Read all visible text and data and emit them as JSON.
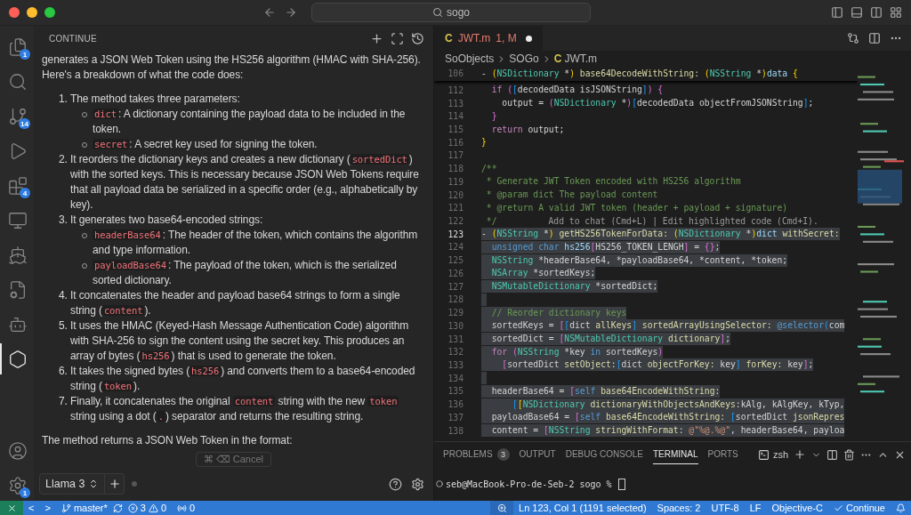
{
  "window": {
    "search": "sogo"
  },
  "activity_bar": {
    "top": [
      {
        "kind": "explorer",
        "badge": "1",
        "selected": false
      },
      {
        "kind": "search",
        "selected": false
      },
      {
        "kind": "source-control",
        "badge": "14",
        "selected": false
      },
      {
        "kind": "run",
        "selected": false
      },
      {
        "kind": "extensions",
        "badge": "4",
        "selected": false
      },
      {
        "kind": "remote",
        "selected": false
      },
      {
        "kind": "docker",
        "selected": false
      },
      {
        "kind": "file-settings",
        "selected": false
      },
      {
        "kind": "robot",
        "selected": false
      },
      {
        "kind": "continue",
        "selected": true
      }
    ],
    "bottom": [
      {
        "kind": "account",
        "selected": false
      },
      {
        "kind": "manage",
        "badge": "1",
        "selected": false
      }
    ]
  },
  "chat": {
    "title": "CONTINUE",
    "blocks": [
      {
        "kind": "paragraph",
        "segments": [
          {
            "text": "generates a JSON Web Token using the HS256 algorithm (HMAC with SHA-256). Here's a breakdown of what the code does:",
            "kind": "text"
          }
        ]
      },
      {
        "kind": "list",
        "items": [
          {
            "number": "1.",
            "segments": [
              {
                "text": "The method takes three parameters:",
                "kind": "text"
              }
            ],
            "children": [
              {
                "segments": [
                  {
                    "text": "dict",
                    "kind": "code"
                  },
                  {
                    "text": ": A dictionary containing the payload data to be included in the token.",
                    "kind": "text"
                  }
                ]
              },
              {
                "segments": [
                  {
                    "text": "secret",
                    "kind": "code"
                  },
                  {
                    "text": ": A secret key used for signing the token.",
                    "kind": "text"
                  }
                ]
              }
            ]
          },
          {
            "number": "2.",
            "segments": [
              {
                "text": "It reorders the dictionary keys and creates a new dictionary (",
                "kind": "text"
              },
              {
                "text": "sortedDict",
                "kind": "code"
              },
              {
                "text": ") with the sorted keys. This is necessary because JSON Web Tokens require that all payload data be serialized in a specific order (e.g., alphabetically by key).",
                "kind": "text"
              }
            ]
          },
          {
            "number": "3.",
            "segments": [
              {
                "text": "It generates two base64-encoded strings:",
                "kind": "text"
              }
            ],
            "children": [
              {
                "segments": [
                  {
                    "text": "headerBase64",
                    "kind": "code"
                  },
                  {
                    "text": ": The header of the token, which contains the algorithm and type information.",
                    "kind": "text"
                  }
                ]
              },
              {
                "segments": [
                  {
                    "text": "payloadBase64",
                    "kind": "code"
                  },
                  {
                    "text": ": The payload of the token, which is the serialized sorted dictionary.",
                    "kind": "text"
                  }
                ]
              }
            ]
          },
          {
            "number": "4.",
            "segments": [
              {
                "text": "It concatenates the header and payload base64 strings to form a single string (",
                "kind": "text"
              },
              {
                "text": "content",
                "kind": "code"
              },
              {
                "text": ").",
                "kind": "text"
              }
            ]
          },
          {
            "number": "5.",
            "segments": [
              {
                "text": "It uses the HMAC (Keyed-Hash Message Authentication Code) algorithm with SHA-256 to sign the content using the secret key. This produces an array of bytes (",
                "kind": "text"
              },
              {
                "text": "hs256",
                "kind": "code"
              },
              {
                "text": ") that is used to generate the token.",
                "kind": "text"
              }
            ]
          },
          {
            "number": "6.",
            "segments": [
              {
                "text": "It takes the signed bytes (",
                "kind": "text"
              },
              {
                "text": "hs256",
                "kind": "code"
              },
              {
                "text": ") and converts them to a base64-encoded string (",
                "kind": "text"
              },
              {
                "text": "token",
                "kind": "code"
              },
              {
                "text": ").",
                "kind": "text"
              }
            ]
          },
          {
            "number": "7.",
            "segments": [
              {
                "text": "Finally, it concatenates the original ",
                "kind": "text"
              },
              {
                "text": "content",
                "kind": "code"
              },
              {
                "text": " string with the new ",
                "kind": "text"
              },
              {
                "text": "token",
                "kind": "code"
              },
              {
                "text": " string using a dot (",
                "kind": "text"
              },
              {
                "text": ".",
                "kind": "code"
              },
              {
                "text": ") separator and returns the resulting string.",
                "kind": "text"
              }
            ]
          }
        ]
      },
      {
        "kind": "paragraph",
        "segments": [
          {
            "text": "The method returns a JSON Web Token in the format:",
            "kind": "text"
          }
        ]
      }
    ],
    "cancel_button": "⌘ ⌫ Cancel",
    "model": "Llama 3"
  },
  "editor": {
    "tab": {
      "icon_letter": "C",
      "name": "JWT.m",
      "status": "1, M",
      "modified": true
    },
    "breadcrumb": [
      {
        "label": "SoObjects"
      },
      {
        "label": "SOGo"
      },
      {
        "icon_letter": "C",
        "label": "JWT.m"
      }
    ],
    "sticky_line": {
      "n": "106",
      "seg": [
        {
          "text": "- ",
          "kind": "p"
        },
        {
          "text": "(",
          "kind": "y"
        },
        {
          "text": "NSDictionary",
          "kind": "t"
        },
        {
          "text": " *",
          "kind": "p"
        },
        {
          "text": ")",
          "kind": "y"
        },
        {
          "text": " base64DecodeWithString: ",
          "kind": "f"
        },
        {
          "text": "(",
          "kind": "y"
        },
        {
          "text": "NSString",
          "kind": "t"
        },
        {
          "text": " *",
          "kind": "p"
        },
        {
          "text": ")",
          "kind": "y"
        },
        {
          "text": "data",
          "kind": "v"
        },
        {
          "text": " {",
          "kind": "y"
        }
      ]
    },
    "lines": [
      {
        "n": "112",
        "selected": false,
        "current": false,
        "seg": [
          {
            "text": "  if ",
            "kind": "k"
          },
          {
            "text": "(",
            "kind": "m"
          },
          {
            "text": "[",
            "kind": "b"
          },
          {
            "text": "decodedData isJSONString",
            "kind": "p"
          },
          {
            "text": "]",
            "kind": "b"
          },
          {
            "text": ")",
            "kind": "m"
          },
          {
            "text": " {",
            "kind": "m"
          }
        ]
      },
      {
        "n": "113",
        "selected": false,
        "current": false,
        "seg": [
          {
            "text": "    output = ",
            "kind": "p"
          },
          {
            "text": "(",
            "kind": "m"
          },
          {
            "text": "NSDictionary",
            "kind": "t"
          },
          {
            "text": " *",
            "kind": "p"
          },
          {
            "text": ")",
            "kind": "m"
          },
          {
            "text": "[",
            "kind": "b"
          },
          {
            "text": "decodedData objectFromJSONString",
            "kind": "p"
          },
          {
            "text": "]",
            "kind": "b"
          },
          {
            "text": ";",
            "kind": "p"
          }
        ]
      },
      {
        "n": "114",
        "selected": false,
        "current": false,
        "seg": [
          {
            "text": "  }",
            "kind": "m"
          }
        ]
      },
      {
        "n": "115",
        "selected": false,
        "current": false,
        "seg": [
          {
            "text": "  return",
            "kind": "k"
          },
          {
            "text": " output;",
            "kind": "p"
          }
        ]
      },
      {
        "n": "116",
        "selected": false,
        "current": false,
        "seg": [
          {
            "text": "}",
            "kind": "y"
          }
        ]
      },
      {
        "n": "117",
        "selected": false,
        "current": false
      },
      {
        "n": "118",
        "selected": false,
        "current": false,
        "seg": [
          {
            "text": "/**",
            "kind": "c"
          }
        ]
      },
      {
        "n": "119",
        "selected": false,
        "current": false,
        "seg": [
          {
            "text": " * Generate JWT Token encoded with HS256 algorithm",
            "kind": "c"
          }
        ]
      },
      {
        "n": "120",
        "selected": false,
        "current": false,
        "seg": [
          {
            "text": " * @param dict The payload content",
            "kind": "c"
          }
        ]
      },
      {
        "n": "121",
        "selected": false,
        "current": false,
        "seg": [
          {
            "text": " * @return A valid JWT token (header + payload + signature)",
            "kind": "c"
          }
        ]
      },
      {
        "n": "122",
        "selected": false,
        "current": false,
        "seg": [
          {
            "text": " */",
            "kind": "c"
          }
        ],
        "hint": "Add to chat (Cmd+L) | Edit highlighted code (Cmd+I)."
      },
      {
        "n": "123",
        "selected": true,
        "current": true,
        "seg": [
          {
            "text": "- ",
            "kind": "p"
          },
          {
            "text": "(",
            "kind": "y"
          },
          {
            "text": "NSString",
            "kind": "t"
          },
          {
            "text": " *",
            "kind": "p"
          },
          {
            "text": ")",
            "kind": "y"
          },
          {
            "text": " getHS256TokenForData: ",
            "kind": "f"
          },
          {
            "text": "(",
            "kind": "y"
          },
          {
            "text": "NSDictionary",
            "kind": "t"
          },
          {
            "text": " *",
            "kind": "p"
          },
          {
            "text": ")",
            "kind": "y"
          },
          {
            "text": "dict",
            "kind": "v"
          },
          {
            "text": " withSecret:",
            "kind": "f"
          }
        ]
      },
      {
        "n": "124",
        "selected": true,
        "current": false,
        "seg": [
          {
            "text": "  unsigned char",
            "kind": "s"
          },
          {
            "text": " hs256",
            "kind": "v"
          },
          {
            "text": "[",
            "kind": "m"
          },
          {
            "text": "HS256_TOKEN_LENGH",
            "kind": "p"
          },
          {
            "text": "]",
            "kind": "m"
          },
          {
            "text": " = ",
            "kind": "p"
          },
          {
            "text": "{}",
            "kind": "m"
          },
          {
            "text": ";",
            "kind": "p"
          }
        ]
      },
      {
        "n": "125",
        "selected": true,
        "current": false,
        "seg": [
          {
            "text": "  NSString",
            "kind": "t"
          },
          {
            "text": " *headerBase64, *payloadBase64, *content, *token;",
            "kind": "p"
          }
        ]
      },
      {
        "n": "126",
        "selected": true,
        "current": false,
        "seg": [
          {
            "text": "  NSArray",
            "kind": "t"
          },
          {
            "text": " *sortedKeys;",
            "kind": "p"
          }
        ]
      },
      {
        "n": "127",
        "selected": true,
        "current": false,
        "seg": [
          {
            "text": "  NSMutableDictionary",
            "kind": "t"
          },
          {
            "text": " *sortedDict;",
            "kind": "p"
          }
        ]
      },
      {
        "n": "128",
        "selected": true,
        "current": false
      },
      {
        "n": "129",
        "selected": true,
        "current": false,
        "seg": [
          {
            "text": "  // Reorder dictionary keys",
            "kind": "c"
          }
        ]
      },
      {
        "n": "130",
        "selected": true,
        "current": false,
        "seg": [
          {
            "text": "  sortedKeys = ",
            "kind": "p"
          },
          {
            "text": "[",
            "kind": "m"
          },
          {
            "text": "[",
            "kind": "b"
          },
          {
            "text": "dict ",
            "kind": "p"
          },
          {
            "text": "allKeys",
            "kind": "f"
          },
          {
            "text": "]",
            "kind": "b"
          },
          {
            "text": " sortedArrayUsingSelector: ",
            "kind": "f"
          },
          {
            "text": "@selector",
            "kind": "s"
          },
          {
            "text": "(",
            "kind": "b"
          },
          {
            "text": "com",
            "kind": "p"
          }
        ]
      },
      {
        "n": "131",
        "selected": true,
        "current": false,
        "seg": [
          {
            "text": "  sortedDict = ",
            "kind": "p"
          },
          {
            "text": "[",
            "kind": "m"
          },
          {
            "text": "NSMutableDictionary",
            "kind": "t"
          },
          {
            "text": " dictionary",
            "kind": "f"
          },
          {
            "text": "]",
            "kind": "m"
          },
          {
            "text": ";",
            "kind": "p"
          }
        ]
      },
      {
        "n": "132",
        "selected": true,
        "current": false,
        "seg": [
          {
            "text": "  for ",
            "kind": "k"
          },
          {
            "text": "(",
            "kind": "m"
          },
          {
            "text": "NSString",
            "kind": "t"
          },
          {
            "text": " *key ",
            "kind": "p"
          },
          {
            "text": "in",
            "kind": "s"
          },
          {
            "text": " sortedKeys",
            "kind": "p"
          },
          {
            "text": ")",
            "kind": "m"
          }
        ]
      },
      {
        "n": "133",
        "selected": true,
        "current": false,
        "seg": [
          {
            "text": "    [",
            "kind": "m"
          },
          {
            "text": "sortedDict ",
            "kind": "p"
          },
          {
            "text": "setObject:",
            "kind": "f"
          },
          {
            "text": "[",
            "kind": "b"
          },
          {
            "text": "dict ",
            "kind": "p"
          },
          {
            "text": "objectForKey: ",
            "kind": "f"
          },
          {
            "text": "key",
            "kind": "p"
          },
          {
            "text": "]",
            "kind": "b"
          },
          {
            "text": " forKey: ",
            "kind": "f"
          },
          {
            "text": "key",
            "kind": "p"
          },
          {
            "text": "]",
            "kind": "m"
          },
          {
            "text": ";",
            "kind": "p"
          }
        ]
      },
      {
        "n": "134",
        "selected": true,
        "current": false
      },
      {
        "n": "135",
        "selected": true,
        "current": false,
        "seg": [
          {
            "text": "  headerBase64 = ",
            "kind": "p"
          },
          {
            "text": "[",
            "kind": "m"
          },
          {
            "text": "self",
            "kind": "s"
          },
          {
            "text": " base64EncodeWithString:",
            "kind": "f"
          }
        ]
      },
      {
        "n": "136",
        "selected": true,
        "current": false,
        "seg": [
          {
            "text": "      [",
            "kind": "b"
          },
          {
            "text": "[",
            "kind": "y"
          },
          {
            "text": "NSDictionary",
            "kind": "t"
          },
          {
            "text": " dictionaryWithObjectsAndKeys:",
            "kind": "f"
          },
          {
            "text": "kAlg, kAlgKey, kTyp,",
            "kind": "p"
          }
        ]
      },
      {
        "n": "137",
        "selected": true,
        "current": false,
        "seg": [
          {
            "text": "  payloadBase64 = ",
            "kind": "p"
          },
          {
            "text": "[",
            "kind": "m"
          },
          {
            "text": "self",
            "kind": "s"
          },
          {
            "text": " base64EncodeWithString: ",
            "kind": "f"
          },
          {
            "text": "[",
            "kind": "b"
          },
          {
            "text": "sortedDict ",
            "kind": "p"
          },
          {
            "text": "jsonRepres",
            "kind": "f"
          }
        ]
      },
      {
        "n": "138",
        "selected": true,
        "current": false,
        "seg": [
          {
            "text": "  content = ",
            "kind": "p"
          },
          {
            "text": "[",
            "kind": "m"
          },
          {
            "text": "NSString",
            "kind": "t"
          },
          {
            "text": " stringWithFormat: ",
            "kind": "f"
          },
          {
            "text": "@\"%@.%@\"",
            "kind": "q"
          },
          {
            "text": ", headerBase64, payloa",
            "kind": "p"
          }
        ]
      }
    ]
  },
  "panel": {
    "tabs": [
      {
        "label": "PROBLEMS",
        "badge": "3",
        "selected": false
      },
      {
        "label": "OUTPUT",
        "selected": false
      },
      {
        "label": "DEBUG CONSOLE",
        "selected": false
      },
      {
        "label": "TERMINAL",
        "selected": true
      },
      {
        "label": "PORTS",
        "selected": false
      }
    ],
    "terminal_profile": "zsh",
    "prompt": "seb@MacBook-Pro-de-Seb-2 sogo %"
  },
  "status_bar": {
    "back": "<",
    "forward": ">",
    "branch": "master*",
    "errors": "3",
    "warnings": "0",
    "ports": "0",
    "position": "Ln 123, Col 1 (1191 selected)",
    "spaces": "Spaces: 2",
    "encoding": "UTF-8",
    "eol": "LF",
    "language": "Objective-C",
    "extension": "Continue"
  }
}
